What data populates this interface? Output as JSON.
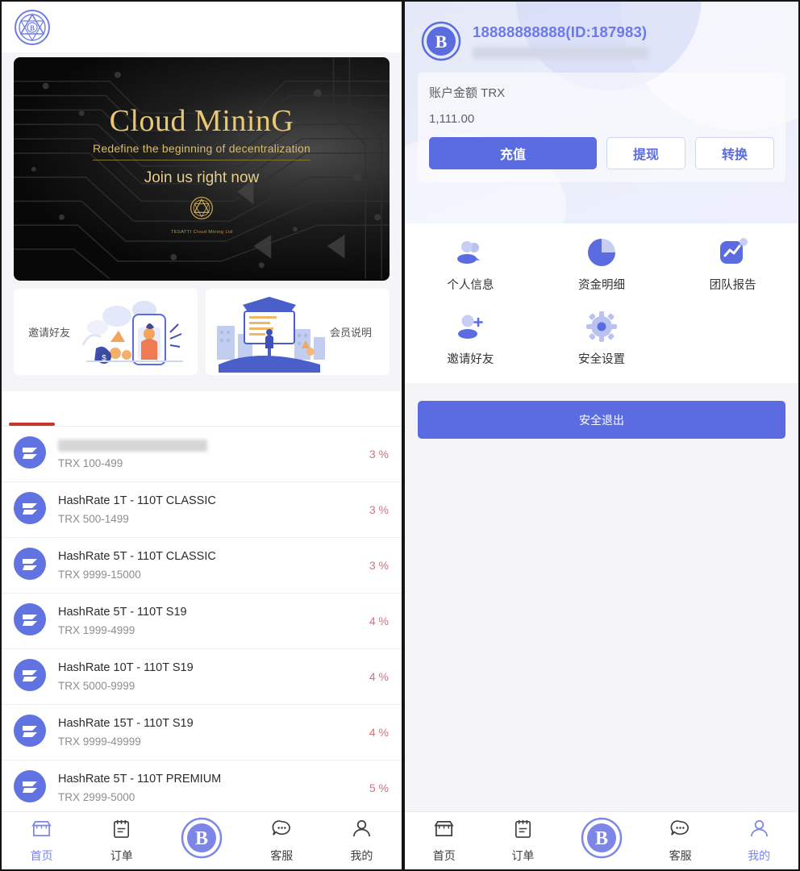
{
  "left": {
    "logo": {
      "icon": "app-logo-icon"
    },
    "banner": {
      "title": "Cloud MininG",
      "subtitle": "Redefine the beginning of decentralization",
      "cta": "Join us right now",
      "brand": "TESATTI Cloud Mining Ltd"
    },
    "promos": [
      {
        "label": "邀请好友",
        "icon": "invite-friends-illustration"
      },
      {
        "label": "会员说明",
        "icon": "member-info-illustration"
      }
    ],
    "tabs": {
      "label": "",
      "active_index": 0
    },
    "products": [
      {
        "name": "",
        "redacted": true,
        "range": "TRX 100-499",
        "pct": "3 %"
      },
      {
        "name": "HashRate 1T - 110T CLASSIC",
        "redacted": false,
        "range": "TRX 500-1499",
        "pct": "3 %"
      },
      {
        "name": "HashRate 5T - 110T CLASSIC",
        "redacted": false,
        "range": "TRX 9999-15000",
        "pct": "3 %"
      },
      {
        "name": "HashRate 5T - 110T S19",
        "redacted": false,
        "range": "TRX 1999-4999",
        "pct": "4 %"
      },
      {
        "name": "HashRate 10T - 110T S19",
        "redacted": false,
        "range": "TRX 5000-9999",
        "pct": "4 %"
      },
      {
        "name": "HashRate 15T - 110T S19",
        "redacted": false,
        "range": "TRX 9999-49999",
        "pct": "4 %"
      },
      {
        "name": "HashRate 5T - 110T PREMIUM",
        "redacted": false,
        "range": "TRX 2999-5000",
        "pct": "5 %"
      }
    ],
    "tabbar": {
      "active": "首页",
      "items": [
        {
          "label": "首页",
          "icon": "home-shop-icon"
        },
        {
          "label": "订单",
          "icon": "order-clipboard-icon"
        },
        {
          "label": "",
          "icon": "bitcoin-center-icon"
        },
        {
          "label": "客服",
          "icon": "support-chat-icon"
        },
        {
          "label": "我的",
          "icon": "profile-person-icon"
        }
      ]
    }
  },
  "right": {
    "profile": {
      "avatar_icon": "bitcoin-avatar-icon",
      "phone_id": "18888888888(ID:187983)",
      "name_redacted": true
    },
    "balance": {
      "label": "账户金额 TRX",
      "value": "1,111.00",
      "actions": [
        {
          "label": "充值",
          "style": "primary"
        },
        {
          "label": "提现",
          "style": "ghost"
        },
        {
          "label": "转换",
          "style": "ghost"
        }
      ]
    },
    "menu": [
      {
        "label": "个人信息",
        "icon": "users-icon",
        "badge": false
      },
      {
        "label": "资金明细",
        "icon": "pie-chart-icon",
        "badge": false
      },
      {
        "label": "团队报告",
        "icon": "trend-report-icon",
        "badge": true
      },
      {
        "label": "邀请好友",
        "icon": "user-add-icon",
        "badge": false
      },
      {
        "label": "安全设置",
        "icon": "gear-icon",
        "badge": false
      }
    ],
    "logout": {
      "label": "安全退出"
    },
    "tabbar": {
      "active": "我的",
      "items": [
        {
          "label": "首页",
          "icon": "home-shop-icon"
        },
        {
          "label": "订单",
          "icon": "order-clipboard-icon"
        },
        {
          "label": "",
          "icon": "bitcoin-center-icon"
        },
        {
          "label": "客服",
          "icon": "support-chat-icon"
        },
        {
          "label": "我的",
          "icon": "profile-person-icon"
        }
      ]
    }
  },
  "colors": {
    "primary": "#5a6ce0",
    "accent_light": "#7b86e8",
    "pct_red": "#d4707f",
    "tab_indicator": "#c0392b",
    "gold": "#e8c872"
  }
}
